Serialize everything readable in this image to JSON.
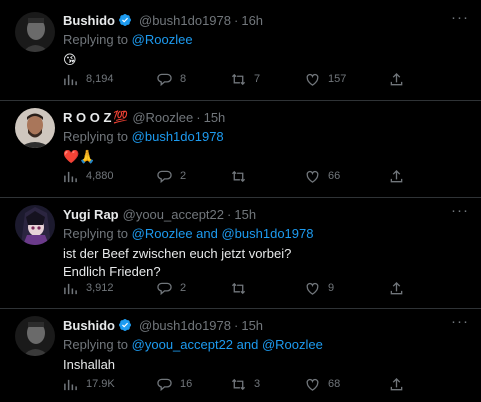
{
  "tweets": [
    {
      "name": "Bushido",
      "name_suffix": "",
      "verified": true,
      "handle": "@bush1do1978",
      "time": "16h",
      "reply_prefix": "Replying to ",
      "reply_to": "@Roozlee",
      "reply_and": "",
      "reply_to2": "",
      "text_lines": [
        "😘"
      ],
      "views": "8,194",
      "replies": "8",
      "retweets": "7",
      "likes": "157"
    },
    {
      "name": "R O O Z",
      "name_suffix": "💯",
      "verified": false,
      "handle": "@Roozlee",
      "time": "15h",
      "reply_prefix": "Replying to ",
      "reply_to": "@bush1do1978",
      "reply_and": "",
      "reply_to2": "",
      "text_lines": [
        "❤️🙏"
      ],
      "views": "4,880",
      "replies": "2",
      "retweets": "",
      "likes": "66"
    },
    {
      "name": "Yugi Rap",
      "name_suffix": "",
      "verified": false,
      "handle": "@yoou_accept22",
      "time": "15h",
      "reply_prefix": "Replying to ",
      "reply_to": "@Roozlee",
      "reply_and": " and ",
      "reply_to2": "@bush1do1978",
      "text_lines": [
        "ist der Beef zwischen euch jetzt vorbei?",
        "Endlich Frieden?"
      ],
      "views": "3,912",
      "replies": "2",
      "retweets": "",
      "likes": "9"
    },
    {
      "name": "Bushido",
      "name_suffix": "",
      "verified": true,
      "handle": "@bush1do1978",
      "time": "15h",
      "reply_prefix": "Replying to ",
      "reply_to": "@yoou_accept22",
      "reply_and": " and ",
      "reply_to2": "@Roozlee",
      "text_lines": [
        "Inshallah"
      ],
      "views": "17.9K",
      "replies": "16",
      "retweets": "3",
      "likes": "68"
    }
  ],
  "icons": {
    "more": "more-icon",
    "views": "analytics-icon",
    "reply": "reply-icon",
    "retweet": "retweet-icon",
    "like": "heart-icon",
    "share": "share-icon"
  },
  "colors": {
    "accent": "#1d9bf0",
    "muted": "#71767b",
    "text": "#e7e9ea",
    "background": "#000000"
  }
}
